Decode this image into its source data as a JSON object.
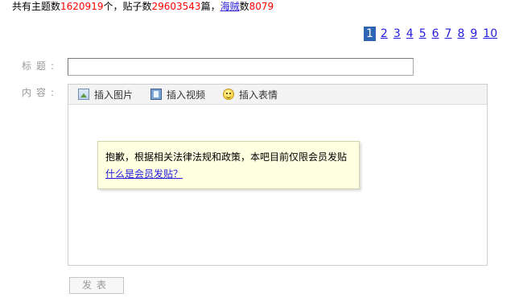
{
  "stats": {
    "topics_prefix": "共有主题数",
    "topics_count": "1620919",
    "topics_suffix": "个，贴子数",
    "posts_count": "29603543",
    "posts_suffix": "篇，",
    "members_link": "海贼",
    "members_prefix": "数",
    "members_count": "8079"
  },
  "pager": {
    "current": "1",
    "pages": [
      "2",
      "3",
      "4",
      "5",
      "6",
      "7",
      "8",
      "9",
      "10"
    ]
  },
  "form": {
    "title_label": "标题:",
    "content_label": "内容:",
    "title_value": ""
  },
  "toolbar": {
    "insert_image": "插入图片",
    "insert_video": "插入视频",
    "insert_emoji": "插入表情"
  },
  "notice": {
    "message": "抱歉，根据相关法律法规和政策，本吧目前仅限会员发贴",
    "link": "什么是会员发贴？"
  },
  "submit_label": "发表"
}
